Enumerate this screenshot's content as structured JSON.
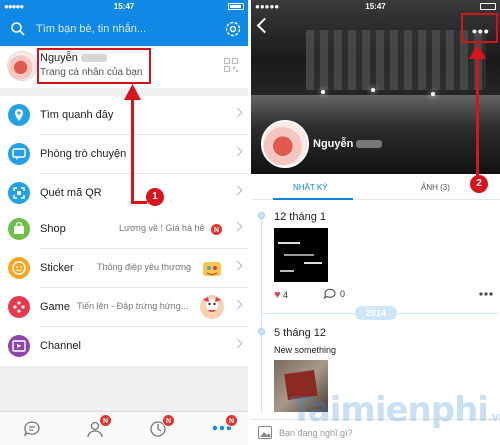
{
  "status_bar": {
    "time": "15:47",
    "signal": "●●●●● ",
    "wifi": "≈"
  },
  "left": {
    "search_placeholder": "Tìm bạn bè, tin nhắn...",
    "profile": {
      "name": "Nguyễn",
      "subtitle": "Trang cá nhân của bạn"
    },
    "menu": [
      {
        "label": "Tìm quanh đây",
        "color": "#23a0e6",
        "hint": "",
        "badge": ""
      },
      {
        "label": "Phòng trò chuyện",
        "color": "#23a0e6",
        "hint": "",
        "badge": ""
      },
      {
        "label": "Quét mã QR",
        "color": "#23a0e6",
        "hint": "",
        "badge": ""
      },
      {
        "label": "Shop",
        "color": "#6cc04a",
        "hint": "Lương về ! Giá hà hê",
        "badge": "N"
      },
      {
        "label": "Sticker",
        "color": "#f5a623",
        "hint": "Thông điệp yêu thương",
        "badge": ""
      },
      {
        "label": "Game",
        "color": "#e8384f",
        "hint": "Tiến lên - Đập trứng hứng...",
        "badge": ""
      },
      {
        "label": "Channel",
        "color": "#8e44ad",
        "hint": "",
        "badge": ""
      }
    ],
    "tabbar": {
      "contacts_badge": "N",
      "diary_badge": "N",
      "more_badge": "N"
    },
    "step_one": "1"
  },
  "right": {
    "profile_name": "Nguyễn",
    "tabs": {
      "diary": "NHẬT KÝ",
      "photos": "ẢNH (3)"
    },
    "posts": [
      {
        "date": "12 tháng 1",
        "likes": "4",
        "comments": "0"
      },
      {
        "date": "5 tháng 12",
        "text": "New something"
      }
    ],
    "year_separator": "2014",
    "composer_placeholder": "Bạn đang nghĩ gì?",
    "more_label": "•••",
    "step_two": "2"
  },
  "watermark": {
    "brand": "Taimienphi",
    "domain": ".vn"
  },
  "colors": {
    "accent": "#0f88e6",
    "highlight_red": "#d0141e"
  }
}
